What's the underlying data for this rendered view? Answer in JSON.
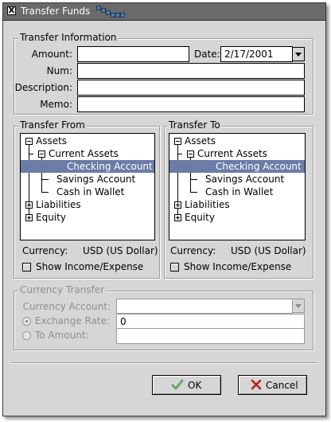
{
  "window": {
    "title": "Transfer Funds",
    "close_glyph": "X"
  },
  "transfer_info": {
    "title": "Transfer Information",
    "amount_label": "Amount:",
    "amount_value": "",
    "date_label": "Date:",
    "date_value": "2/17/2001",
    "num_label": "Num:",
    "num_value": "",
    "description_label": "Description:",
    "description_value": "",
    "memo_label": "Memo:",
    "memo_value": ""
  },
  "transfer_from": {
    "title": "Transfer From",
    "tree": {
      "assets": "Assets",
      "current_assets": "Current Assets",
      "checking": "Checking Account",
      "savings": "Savings Account",
      "cash": "Cash in Wallet",
      "liabilities": "Liabilities",
      "equity": "Equity"
    },
    "selected": "Checking Account",
    "currency_label": "Currency:",
    "currency_value": "USD (US Dollar)",
    "show_income_expense": "Show Income/Expense"
  },
  "transfer_to": {
    "title": "Transfer To",
    "tree": {
      "assets": "Assets",
      "current_assets": "Current Assets",
      "checking": "Checking Account",
      "savings": "Savings Account",
      "cash": "Cash in Wallet",
      "liabilities": "Liabilities",
      "equity": "Equity"
    },
    "selected": "Checking Account",
    "currency_label": "Currency:",
    "currency_value": "USD (US Dollar)",
    "show_income_expense": "Show Income/Expense"
  },
  "currency_transfer": {
    "title": "Currency Transfer",
    "currency_account_label": "Currency Account:",
    "currency_account_value": "",
    "exchange_rate_label": "Exchange Rate:",
    "exchange_rate_value": "0",
    "to_amount_label": "To Amount:",
    "to_amount_value": "",
    "selected_option": "Exchange Rate"
  },
  "buttons": {
    "ok_label": "OK",
    "ok_icon": "check-icon",
    "cancel_label": "Cancel",
    "cancel_icon": "x-icon"
  },
  "colors": {
    "selection": "#6b7ca6",
    "titlebar": "#6a6a6a",
    "window_bg": "#d6d6d6",
    "disabled_text": "#8f8f8f"
  }
}
